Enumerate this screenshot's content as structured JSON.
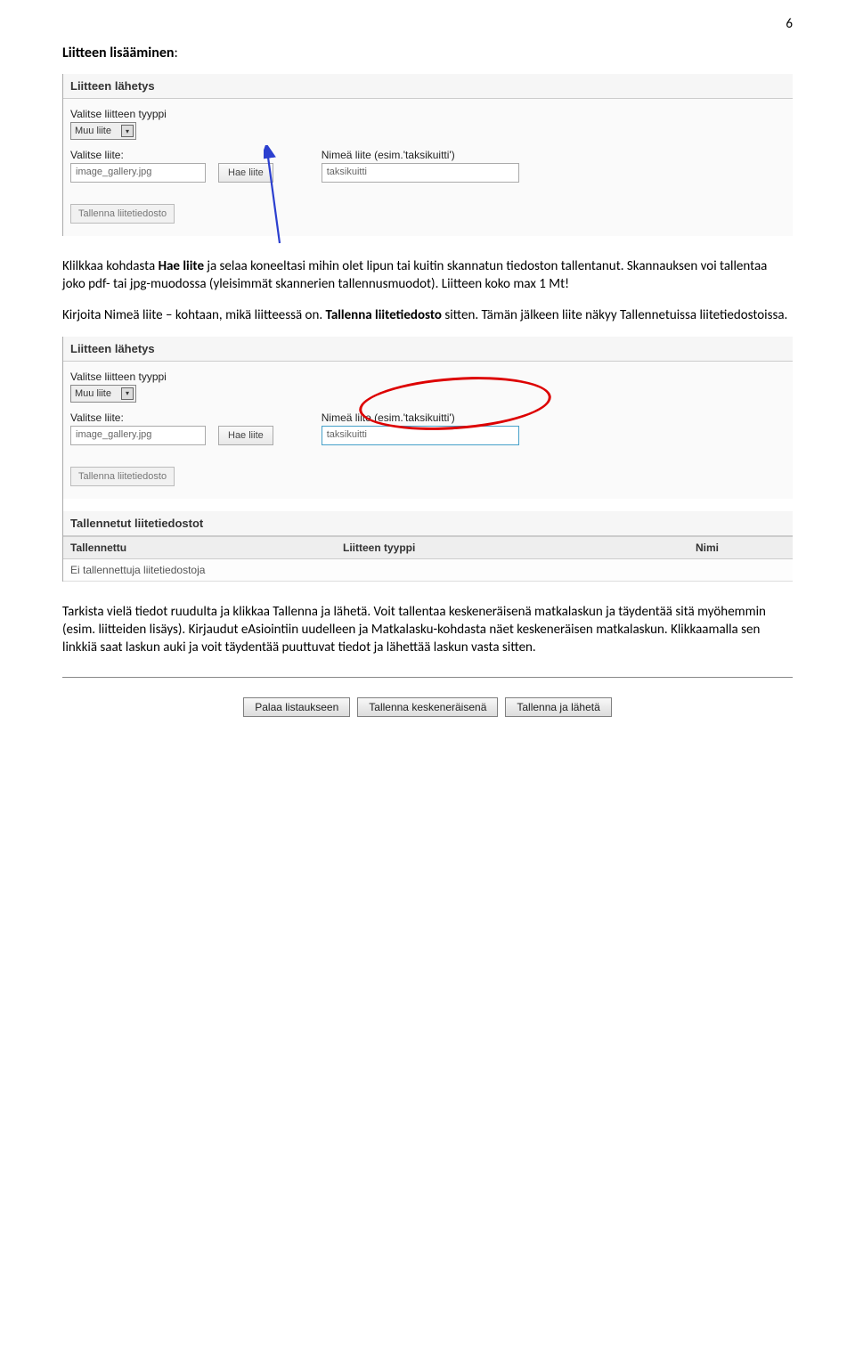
{
  "page_number": "6",
  "heading": "Liitteen lisääminen",
  "heading_suffix": ":",
  "intro1_pre": "Klilkkaa kohdasta ",
  "intro1_bold": "Hae liite",
  "intro1_post": " ja selaa koneeltasi mihin olet lipun tai kuitin skannatun tiedoston tallentanut. Skannauksen voi tallentaa joko pdf- tai jpg-muodossa (yleisimmät skannerien tallennusmuodot). Liitteen koko max 1 Mt!",
  "intro2_pre": "Kirjoita Nimeä liite – kohtaan, mikä liitteessä on. ",
  "intro2_bold": "Tallenna liitetiedosto",
  "intro2_post": " sitten. Tämän jälkeen liite näkyy Tallennetuissa liitetiedostoissa.",
  "final_para": "Tarkista vielä tiedot ruudulta ja klikkaa Tallenna ja lähetä. Voit tallentaa keskeneräisenä matkalaskun ja täydentää sitä myöhemmin (esim. liitteiden lisäys). Kirjaudut eAsiointiin uudelleen ja Matkalasku-kohdasta näet keskeneräisen matkalaskun. Klikkaamalla sen linkkiä saat laskun auki ja voit täydentää puuttuvat tiedot ja lähettää laskun vasta sitten.",
  "panel": {
    "title": "Liitteen lähetys",
    "type_label": "Valitse liitteen tyyppi",
    "type_value": "Muu liite",
    "file_label": "Valitse liite:",
    "file_value": "image_gallery.jpg",
    "browse_btn": "Hae liite",
    "name_label": "Nimeä liite (esim.'taksikuitti')",
    "name_value": "taksikuitti",
    "save_btn": "Tallenna liitetiedosto"
  },
  "saved": {
    "title": "Tallennetut liitetiedostot",
    "col1": "Tallennettu",
    "col2": "Liitteen tyyppi",
    "col3": "Nimi",
    "empty": "Ei tallennettuja liitetiedostoja"
  },
  "footer": {
    "back": "Palaa listaukseen",
    "draft": "Tallenna keskeneräisenä",
    "send": "Tallenna ja lähetä"
  }
}
